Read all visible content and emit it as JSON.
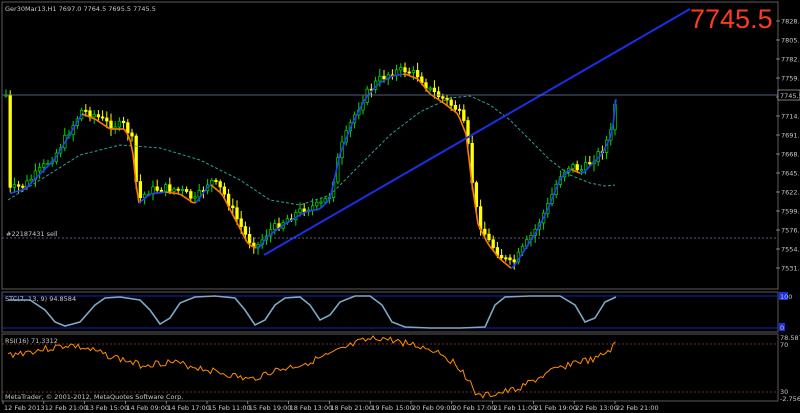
{
  "window": {
    "title": "Ger30Mar13,H1  7697.0 7764.5 7695.5 7745.5",
    "copyright": "MetaTrader, © 2001-2012, MetaQuotes Software Corp."
  },
  "overlay": {
    "last_price_big": "7745.5",
    "order_line_label": "#22187431 sell",
    "current_price_tag": "7745.5"
  },
  "colors": {
    "background": "#000000",
    "bull_candle": "#00e000",
    "bear_candle": "#ffff00",
    "price_line": "#9aa0ff",
    "ma_dashed": "#2aa198",
    "trendline": "#1a2fe8",
    "ma_fast_up": "#2040ff",
    "ma_fast_down": "#ff7a00",
    "stc_line": "#7fa9c4",
    "rsi_line": "#ff8c00",
    "level_red": "#c0392b",
    "big_price": "#ff3b1f",
    "grid_text": "#c8c8c8"
  },
  "main_panel": {
    "price_axis_labels": [
      "7828.6",
      "7805.7",
      "7782.7",
      "7759.8",
      "7737.0",
      "7714.1",
      "7691.1",
      "7668.2",
      "7645.5",
      "7622.5",
      "7599.7",
      "7576.8",
      "7554.0",
      "7531.0"
    ],
    "order_line_price": 7587
  },
  "stc_panel": {
    "header": "STC(7, 13, 9) 94.8584",
    "axis_labels": [
      "100",
      "0"
    ],
    "levels": [
      100,
      0
    ]
  },
  "rsi_panel": {
    "header": "RSI(16) 71.3312",
    "axis_labels": [
      "78.587",
      "70",
      "30",
      "-2.7567"
    ],
    "levels": [
      70,
      30
    ]
  },
  "time_axis_labels": [
    "12 Feb 2013",
    "12 Feb 21:00",
    "13 Feb 15:00",
    "14 Feb 09:00",
    "14 Feb 17:00",
    "15 Feb 11:00",
    "15 Feb 19:00",
    "18 Feb 13:00",
    "18 Feb 21:00",
    "19 Feb 15:00",
    "20 Feb 09:00",
    "20 Feb 17:00",
    "21 Feb 11:00",
    "21 Feb 19:00",
    "22 Feb 13:00",
    "22 Feb 21:00"
  ]
}
